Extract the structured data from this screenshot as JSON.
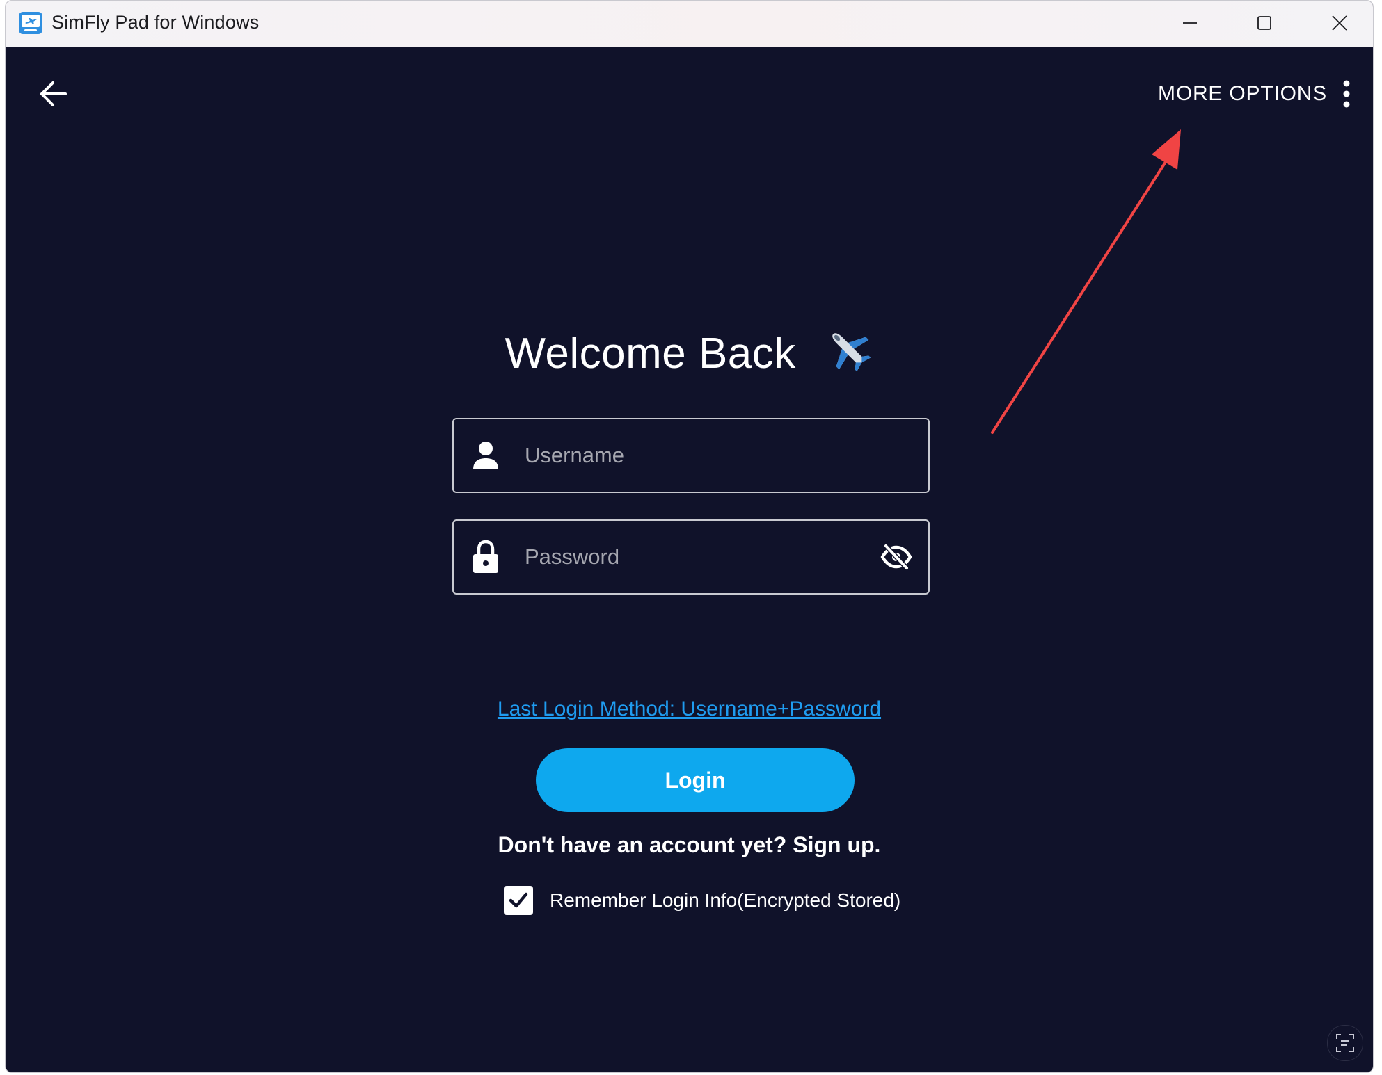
{
  "window": {
    "title": "SimFly Pad for Windows",
    "icon": "simfly-app-icon"
  },
  "titlebar_controls": {
    "minimize_icon": "minimize-icon",
    "maximize_icon": "maximize-icon",
    "close_icon": "close-icon"
  },
  "header": {
    "back_icon": "arrow-left-icon",
    "more_options_label": "MORE OPTIONS",
    "more_options_icon": "vertical-dots-icon"
  },
  "login": {
    "heading": "Welcome Back",
    "heading_icon": "airplane-emoji",
    "username": {
      "placeholder": "Username",
      "value": "",
      "icon": "person-icon"
    },
    "password": {
      "placeholder": "Password",
      "value": "",
      "icon": "lock-icon",
      "visibility_icon": "eye-off-icon"
    },
    "last_login_link": "Last Login Method: Username+Password",
    "login_button": "Login",
    "signup_text": "Don't have an account yet? Sign up.",
    "remember": {
      "label": "Remember Login Info(Encrypted Stored)",
      "checked": true
    }
  },
  "footer": {
    "corner_icon": "scan-text-icon"
  },
  "colors": {
    "background": "#10122a",
    "accent": "#0ea8ee",
    "link": "#1f9cf0",
    "annotation_arrow": "#f04444"
  }
}
